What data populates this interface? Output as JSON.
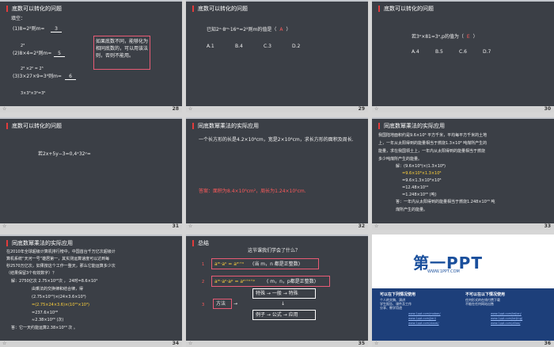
{
  "slides": [
    {
      "title": "底数可以转化的问题",
      "num": "28",
      "fill_label": "填空：",
      "lines": [
        "(1)8=2²则m=",
        "3",
        "2³",
        "(2)8×4=2³则m=",
        "5",
        "2³ ×2² = 2⁵",
        "(3)3×27×9=3⁴则m=",
        "6",
        "3×3³×3²=3⁶"
      ],
      "note": "如果底数不同，能够化为相同底数的，可以用该法则，否则不能用。"
    },
    {
      "title": "底数可以转化的问题",
      "num": "29",
      "question": "已知2ˣ·8ᵐ·16ᵐ=2²则m的值是（",
      "answer": "A",
      "close": "）",
      "options": [
        "A.1",
        "B.4",
        "C.3",
        "D.2"
      ]
    },
    {
      "title": "底数可以转化的问题",
      "num": "30",
      "question": "若3ⁿ×81=3ⁿ,p的值为（",
      "answer": "E",
      "close": "）",
      "options": [
        "A.4",
        "B.5",
        "C.6",
        "D.7"
      ]
    },
    {
      "title": "底数可以转化的问题",
      "num": "31",
      "question": "若2x+5y−3=0,4ˣ32ʸ="
    },
    {
      "title": "同底数幂乘法的实际应用",
      "num": "32",
      "problem": "一个长方形的长是4.2×10⁴cm，宽是2×10⁴cm，求长方形的面积及周长.",
      "answer": "答案：面积为8.4×10⁸cm²，周长为1.24×10⁵cm."
    },
    {
      "title": "同底数幂乘法的实际应用",
      "num": "33",
      "problem": [
        "我国陆地面积约是9.6×10⁶  平方千米，平均每平方千米的土地",
        "上，一年从太阳得到的能量相当于燃烧1.3×10⁸  吨煤所产生的",
        "能量，求在我国领土上，一年内从太阳得到的能量相当于燃烧",
        "多少吨煤所产生的能量。"
      ],
      "solution": [
        "解：(9.6×10⁶)×(1.3×10⁸)",
        "=9.6×10⁶×1.3×10⁸",
        "=9.6×1.3×10⁶×10⁸",
        "=12.48×10¹⁴",
        "=1.248×10¹⁵ (吨)"
      ],
      "result": [
        "答：一年内从太阳得到的能量相当于燃烧1.248×10¹⁵  吨",
        "煤所产生的能量。"
      ]
    },
    {
      "title": "同底数幂乘法的实际应用",
      "num": "34",
      "problem": [
        "在2010年全球超级计算机排行榜中，中国首台千万亿次超级计",
        "算机系统“天河一号”雄居第一，其实测运算速度可以达到每",
        "秒2570万亿次，如果按这个工作一整天，那么它能运算多少次",
        "（结果保留3个有效数字）？"
      ],
      "solution": [
        "解：2750亿次 2.75×10¹⁵次  ，  24时=8.6×10⁴",
        "由乘法的交换律和结合律，得",
        "(2.75×10¹⁵)×(24×3.6×10³)",
        "=(2.75×24×3.6)×(10¹⁵×10³)",
        "=237.6×10¹⁸",
        "≈2.38×10²⁰  (次)"
      ],
      "result": "答：它一天约能运算2.38×10²⁰ 次 。"
    },
    {
      "title": "总结",
      "num": "35",
      "heading": "这节课我们学会了什么？",
      "item1_formula": "aᵐ·aⁿ = aᵐ⁺ⁿ",
      "item1_cond": "(当 m，n 都是正整数)",
      "item2_formula": "aᵐ·aⁿ·aᵖ = aᵐ⁺ⁿ⁺ᵖ",
      "item2_cond": "( m，n，p都是正整数)",
      "method": "方法",
      "flow1": "特殊 → 一般 → 特殊",
      "flow2": "例子 → 公式 → 应用",
      "markers": [
        "1",
        "2",
        "3"
      ]
    },
    {
      "title": "",
      "num": "36",
      "brand": "第一PPT",
      "url": "WWW.1PPT.COM",
      "left_head": "可以在下列情况使用",
      "left_sub": [
        "个人的文稿、演讲",
        "学生报告、课件及工作",
        "分享、教学用途"
      ],
      "right_head": "不可以在以下情况使用",
      "right_sub": [
        "任何形式的在线付费下载",
        "不能在任何网站出售"
      ],
      "links": [
        "www.1ppt.com/moban/",
        "www.1ppt.com/jieri/",
        "www.1ppt.com/xiazai/",
        "www.1ppt.com/kejian/",
        "www.1ppt.com/beijing/",
        "www.1ppt.com/ziliao/"
      ]
    }
  ],
  "colors": {
    "slide_bg": "#3b3f46",
    "accent_red": "#e23b3b",
    "formula_red": "#ff5a5a",
    "formula_yellow": "#ffd23d",
    "footer": "#d3d3d3"
  }
}
